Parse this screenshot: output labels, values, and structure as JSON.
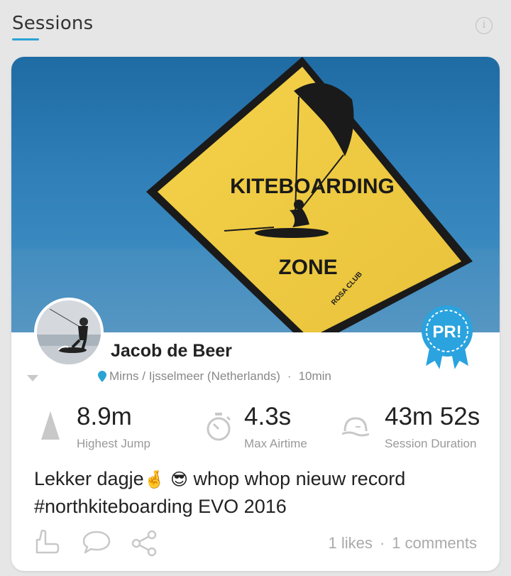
{
  "header": {
    "title": "Sessions",
    "info_icon": "info-icon"
  },
  "cover": {
    "sign_line1": "KITEBOARDING",
    "sign_line2": "ZONE",
    "sign_small": "ROSA CLUB"
  },
  "badge": {
    "label": "PR!",
    "color": "#2aa3df"
  },
  "user": {
    "name": "Jacob de Beer"
  },
  "location": {
    "place": "Mirns / Ijsselmeer (Netherlands)",
    "separator": "·",
    "time_ago": "10min"
  },
  "stats": [
    {
      "icon": "mountain-icon",
      "value": "8.9m",
      "label": "Highest Jump"
    },
    {
      "icon": "stopwatch-icon",
      "value": "4.3s",
      "label": "Max Airtime"
    },
    {
      "icon": "session-duration-icon",
      "value": "43m 52s",
      "label": "Session Duration"
    }
  ],
  "caption": {
    "line1_a": "Lekker dagje",
    "emoji_hand": "🤞",
    "emoji_cool": "😎",
    "line1_b": " whop whop nieuw record",
    "line2": "#northkiteboarding EVO 2016"
  },
  "footer": {
    "likes": "1 likes",
    "separator": "·",
    "comments": "1 comments"
  },
  "colors": {
    "accent": "#29a3d6",
    "text_dark": "#222222",
    "text_muted": "#999999"
  }
}
